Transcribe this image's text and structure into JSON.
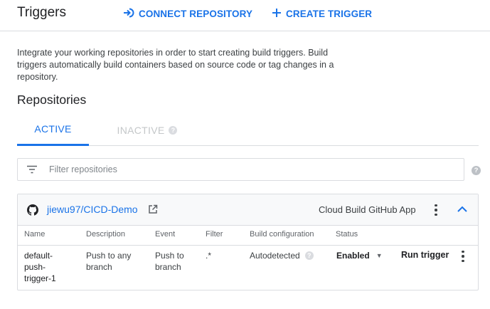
{
  "header": {
    "title": "Triggers",
    "connect_label": "CONNECT REPOSITORY",
    "create_label": "CREATE TRIGGER"
  },
  "intro": "Integrate your working repositories in order to start creating build triggers. Build triggers automatically build containers based on source code or tag changes in a repository.",
  "repositories": {
    "title": "Repositories",
    "tabs": [
      {
        "label": "ACTIVE",
        "active": true
      },
      {
        "label": "INACTIVE",
        "active": false
      }
    ],
    "filter_placeholder": "Filter repositories"
  },
  "repo": {
    "name": "jiewu97/CICD-Demo",
    "app": "Cloud Build GitHub App",
    "columns": [
      "Name",
      "Description",
      "Event",
      "Filter",
      "Build configuration",
      "Status"
    ],
    "rows": [
      {
        "name": "default-push-trigger-1",
        "description": "Push to any branch",
        "event": "Push to branch",
        "filter": ".*",
        "build_config": "Autodetected",
        "status": "Enabled",
        "action": "Run trigger"
      }
    ]
  },
  "icons": {
    "connect": "connect-repository-icon",
    "create": "plus-icon",
    "filter": "filter-icon",
    "help": "help-icon",
    "github": "github-icon",
    "open": "open-in-new-icon",
    "menu": "more-vert-icon",
    "collapse": "chevron-up-icon",
    "dropdown": "caret-down-icon"
  },
  "colors": {
    "accent": "#1a73e8",
    "text": "#202124",
    "secondary_text": "#5f6368",
    "border": "#dadce0",
    "disabled": "#c4c7c9"
  }
}
